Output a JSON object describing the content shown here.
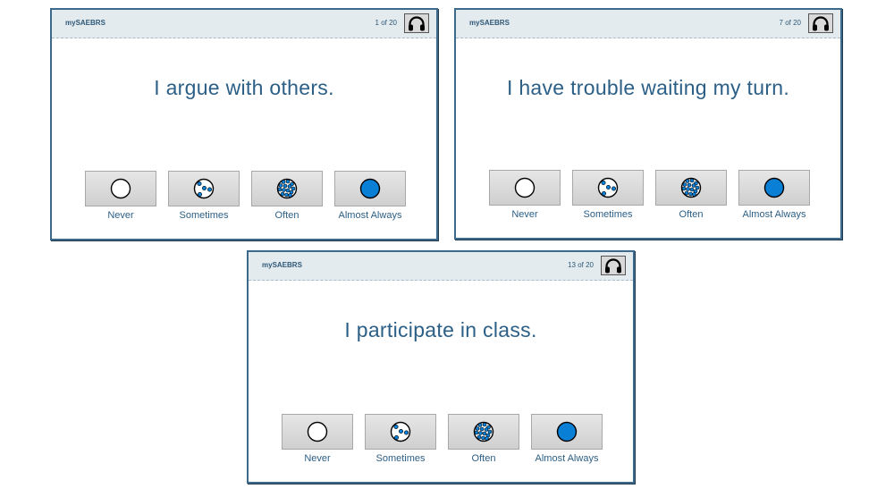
{
  "options": [
    {
      "label": "Never",
      "icon": "empty-circle-icon"
    },
    {
      "label": "Sometimes",
      "icon": "few-dots-circle-icon"
    },
    {
      "label": "Often",
      "icon": "many-dots-circle-icon"
    },
    {
      "label": "Almost Always",
      "icon": "filled-circle-icon"
    }
  ],
  "screens": [
    {
      "app_title": "mySAEBRS",
      "progress": "1 of 20",
      "question": "I argue with others."
    },
    {
      "app_title": "mySAEBRS",
      "progress": "7 of 20",
      "question": "I have trouble waiting my turn."
    },
    {
      "app_title": "mySAEBRS",
      "progress": "13 of 20",
      "question": "I participate in class."
    }
  ],
  "colors": {
    "accent": "#0a7fd6",
    "frame": "#3d6a8a",
    "text": "#2c5f86"
  }
}
